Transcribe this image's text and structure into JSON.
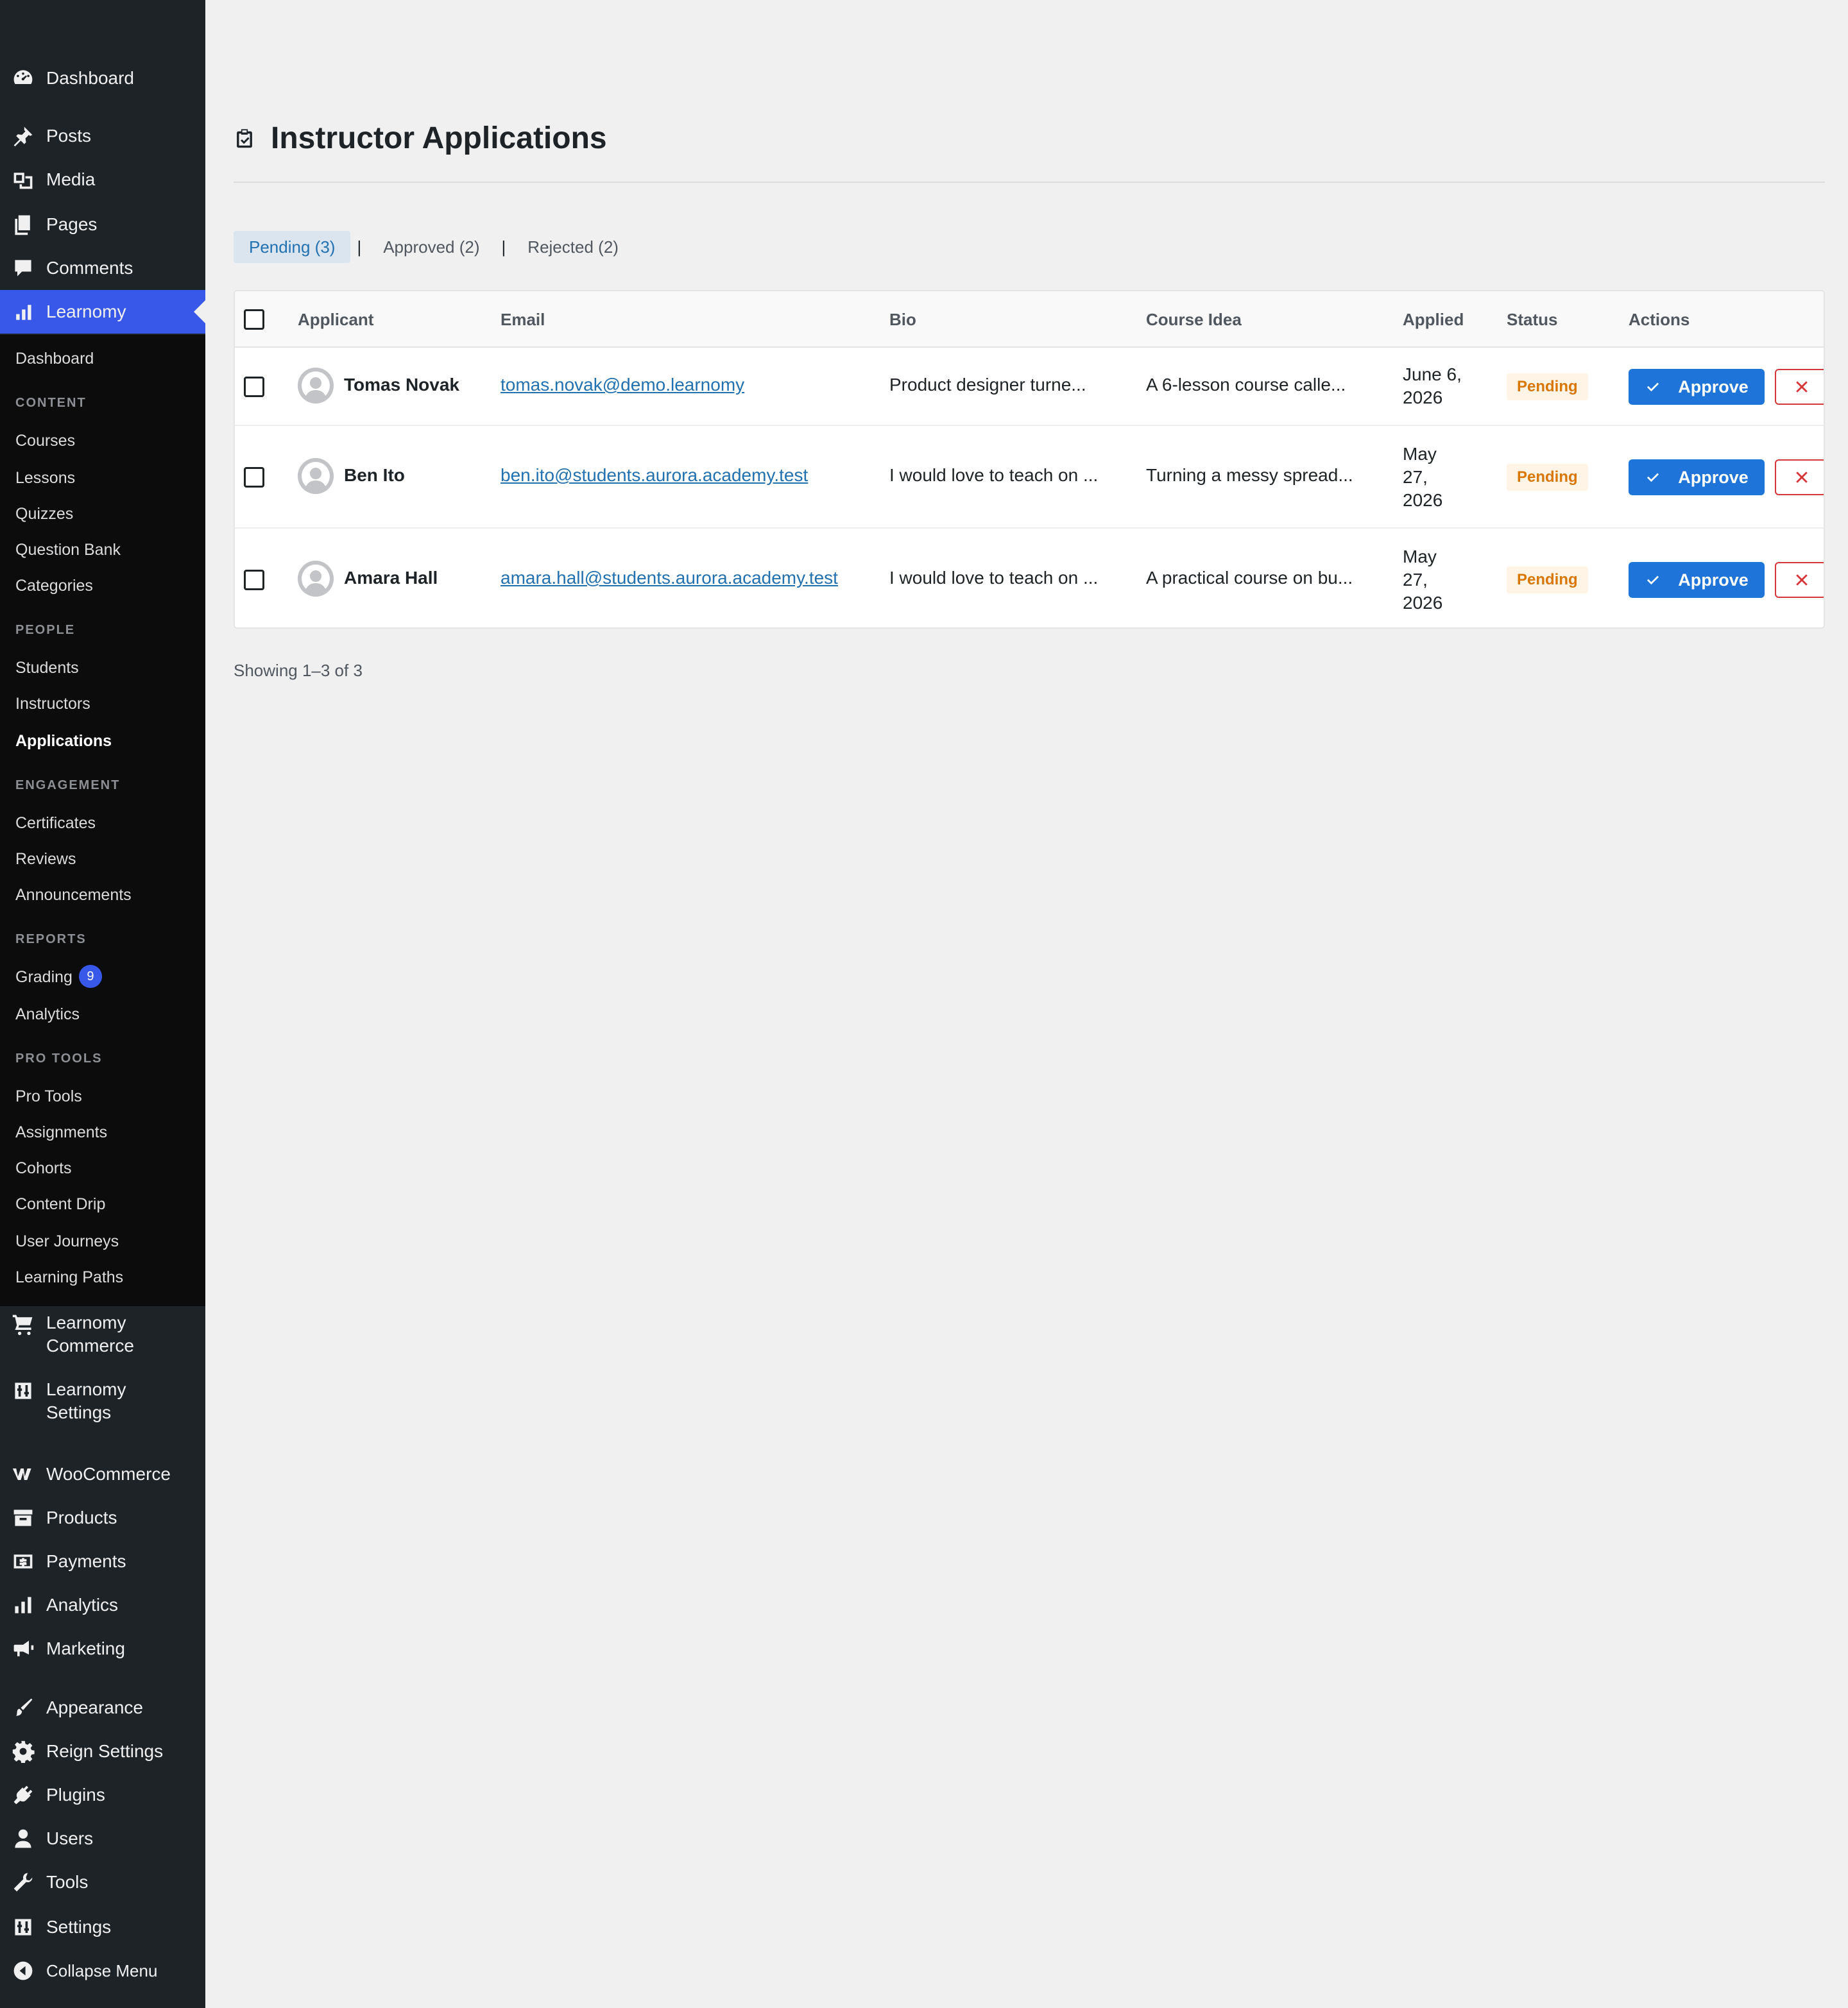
{
  "sidebar": {
    "top_items": [
      {
        "label": "Dashboard",
        "icon": "dashboard-icon"
      },
      {
        "label": "Posts",
        "icon": "pushpin-icon"
      },
      {
        "label": "Media",
        "icon": "media-icon"
      },
      {
        "label": "Pages",
        "icon": "pages-icon"
      },
      {
        "label": "Comments",
        "icon": "comment-icon"
      },
      {
        "label": "Learnomy",
        "icon": "bar-chart-icon"
      }
    ],
    "sub": {
      "dashboard": "Dashboard",
      "content_head": "CONTENT",
      "courses": "Courses",
      "lessons": "Lessons",
      "quizzes": "Quizzes",
      "question_bank": "Question Bank",
      "categories": "Categories",
      "people_head": "PEOPLE",
      "students": "Students",
      "instructors": "Instructors",
      "applications": "Applications",
      "engagement_head": "ENGAGEMENT",
      "certificates": "Certificates",
      "reviews": "Reviews",
      "announcements": "Announcements",
      "reports_head": "REPORTS",
      "grading": "Grading",
      "grading_count": "9",
      "analytics": "Analytics",
      "protools_head": "PRO TOOLS",
      "pro_tools": "Pro Tools",
      "assignments": "Assignments",
      "cohorts": "Cohorts",
      "content_drip": "Content Drip",
      "user_journeys": "User Journeys",
      "learning_paths": "Learning Paths"
    },
    "bottom_items": [
      {
        "label1": "Learnomy",
        "label2": "Commerce",
        "icon": "cart-icon"
      },
      {
        "label1": "Learnomy",
        "label2": "Settings",
        "icon": "settings-sliders-icon"
      },
      {
        "label": "WooCommerce",
        "icon": "woocommerce-icon"
      },
      {
        "label": "Products",
        "icon": "archive-icon"
      },
      {
        "label": "Payments",
        "icon": "dollar-icon"
      },
      {
        "label": "Analytics",
        "icon": "bar-chart-icon"
      },
      {
        "label": "Marketing",
        "icon": "megaphone-icon"
      },
      {
        "label": "Appearance",
        "icon": "paintbrush-icon"
      },
      {
        "label": "Reign Settings",
        "icon": "gear-icon"
      },
      {
        "label": "Plugins",
        "icon": "plug-icon"
      },
      {
        "label": "Users",
        "icon": "user-icon"
      },
      {
        "label": "Tools",
        "icon": "wrench-icon"
      },
      {
        "label": "Settings",
        "icon": "settings-sliders-icon"
      },
      {
        "label": "Collapse Menu",
        "icon": "collapse-icon"
      }
    ]
  },
  "page": {
    "title": "Instructor Applications",
    "title_icon": "clipboard-check-icon"
  },
  "filters": {
    "pending": "Pending",
    "pending_count": "(3)",
    "approved": "Approved",
    "approved_count": "(2)",
    "rejected": "Rejected",
    "rejected_count": "(2)",
    "sep": "|"
  },
  "table": {
    "columns": [
      "Applicant",
      "Email",
      "Bio",
      "Course Idea",
      "Applied",
      "Status",
      "Actions"
    ],
    "rows": [
      {
        "name": "Tomas Novak",
        "email": "tomas.novak@demo.learnomy",
        "bio": "Product designer turne...",
        "idea": "A 6-lesson course calle...",
        "date_lines": [
          "June 6,",
          "2026"
        ],
        "status": "Pending",
        "approve": "Approve"
      },
      {
        "name": "Ben Ito",
        "email": "ben.ito@students.aurora.academy.test",
        "bio": "I would love to teach on ...",
        "idea": "Turning a messy spread...",
        "date_lines": [
          "May",
          "27,",
          "2026"
        ],
        "status": "Pending",
        "approve": "Approve"
      },
      {
        "name": "Amara Hall",
        "email": "amara.hall@students.aurora.academy.test",
        "bio": "I would love to teach on ...",
        "idea": "A practical course on bu...",
        "date_lines": [
          "May",
          "27,",
          "2026"
        ],
        "status": "Pending",
        "approve": "Approve"
      }
    ]
  },
  "footer": {
    "showing": "Showing 1–3 of 3"
  },
  "colors": {
    "sidebar_bg": "#1d2327",
    "submenu_bg": "#0c0c0c",
    "accent": "#3858e9",
    "link": "#2271b1",
    "approve": "#1e74d8",
    "reject": "#d63638",
    "pending": "#d97706"
  }
}
